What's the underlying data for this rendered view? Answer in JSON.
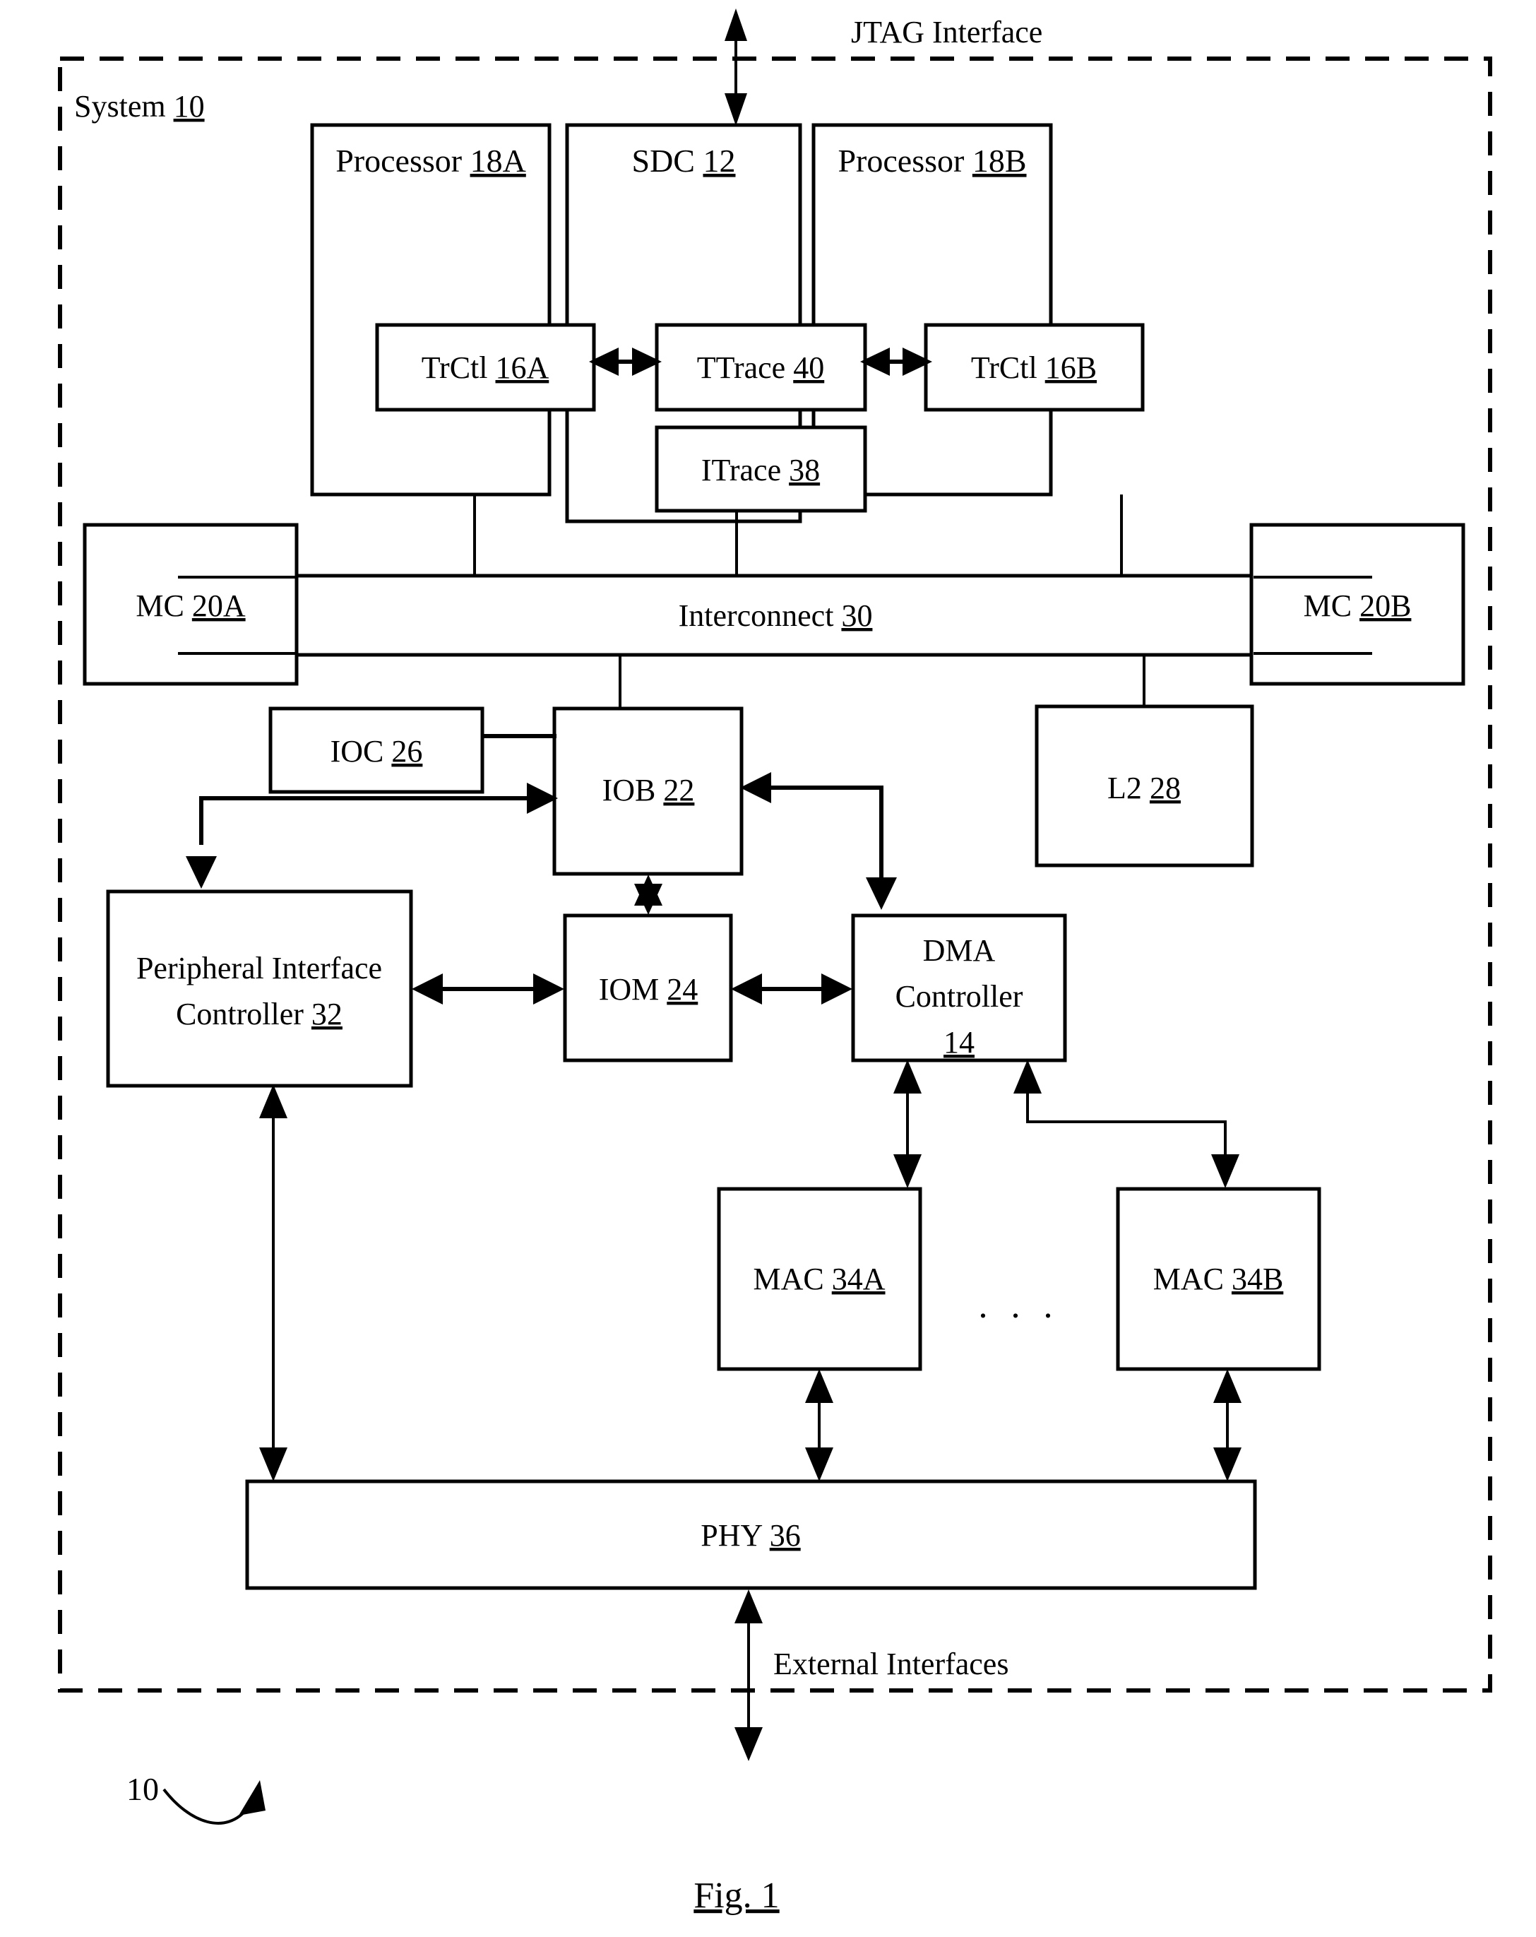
{
  "figure": {
    "caption": "Fig. 1",
    "ref_callout": "10",
    "system_label": "System",
    "system_number": "10",
    "top_interface_label": "JTAG Interface",
    "bottom_interface_label": "External Interfaces",
    "ellipsis": ". . ."
  },
  "blocks": {
    "processor_a": {
      "name": "Processor",
      "number": "18A"
    },
    "sdc": {
      "name": "SDC",
      "number": "12"
    },
    "processor_b": {
      "name": "Processor",
      "number": "18B"
    },
    "trctl_a": {
      "name": "TrCtl",
      "number": "16A"
    },
    "ttrace": {
      "name": "TTrace",
      "number": "40"
    },
    "trctl_b": {
      "name": "TrCtl",
      "number": "16B"
    },
    "itrace": {
      "name": "ITrace",
      "number": "38"
    },
    "mc_a": {
      "name": "MC",
      "number": "20A"
    },
    "interconnect": {
      "name": "Interconnect",
      "number": "30"
    },
    "mc_b": {
      "name": "MC",
      "number": "20B"
    },
    "ioc": {
      "name": "IOC",
      "number": "26"
    },
    "iob": {
      "name": "IOB",
      "number": "22"
    },
    "l2": {
      "name": "L2",
      "number": "28"
    },
    "pic": {
      "name_line1": "Peripheral Interface",
      "name_line2": "Controller",
      "number": "32"
    },
    "iom": {
      "name": "IOM",
      "number": "24"
    },
    "dma": {
      "name_line1": "DMA",
      "name_line2": "Controller",
      "number": "14"
    },
    "mac_a": {
      "name": "MAC",
      "number": "34A"
    },
    "mac_b": {
      "name": "MAC",
      "number": "34B"
    },
    "phy": {
      "name": "PHY",
      "number": "36"
    }
  },
  "colors": {
    "ink": "#000000",
    "paper": "#ffffff"
  }
}
